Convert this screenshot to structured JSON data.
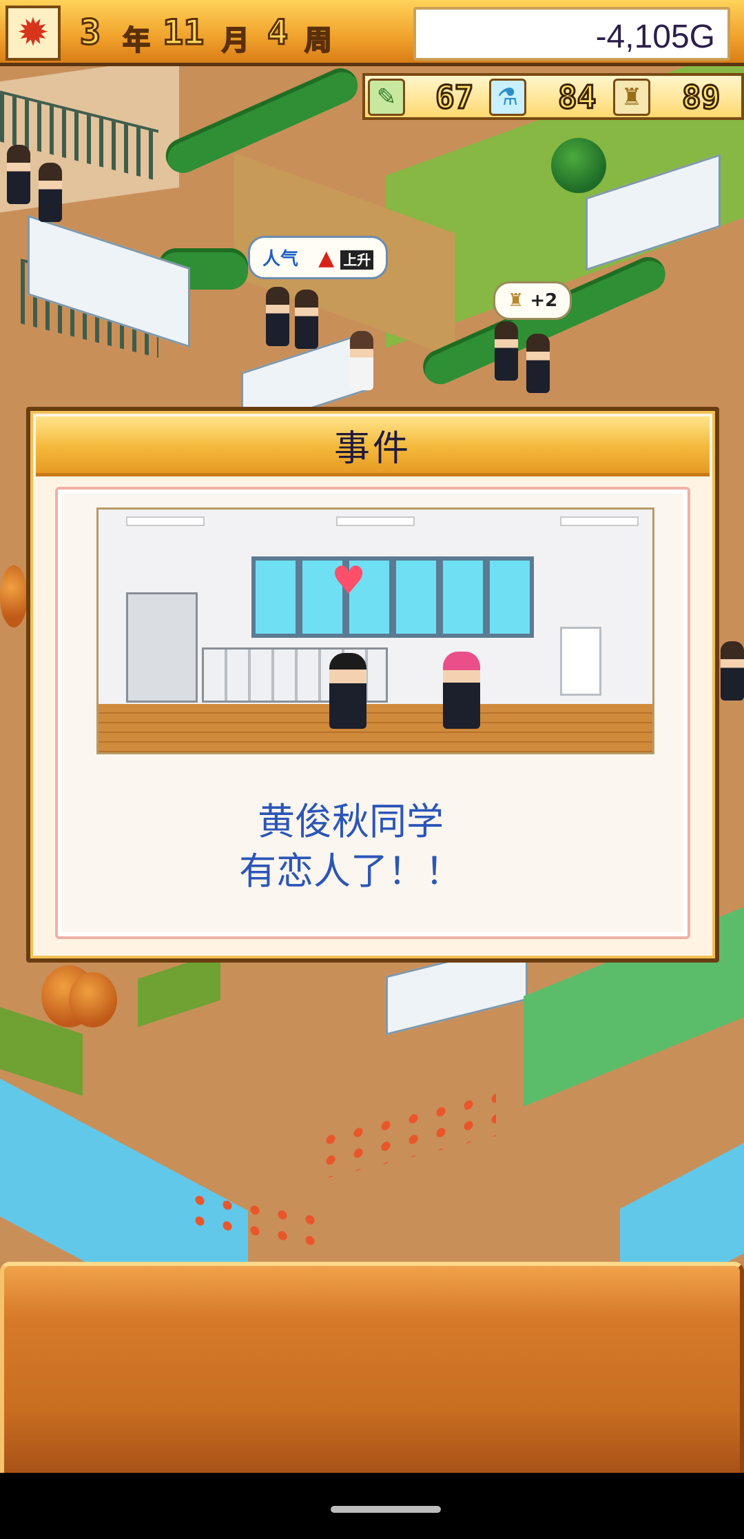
{
  "top_bar": {
    "season_icon": "maple-leaf-icon",
    "date": {
      "year": "3",
      "year_unit": "年",
      "month": "11",
      "month_unit": "月",
      "week": "4",
      "week_unit": "周"
    },
    "money": "-4,105G"
  },
  "stats": [
    {
      "icon": "pencil-icon",
      "value": "67"
    },
    {
      "icon": "flask-icon",
      "value": "84"
    },
    {
      "icon": "trophy-icon",
      "value": "89"
    }
  ],
  "world_bubbles": {
    "popularity": {
      "text": "人气",
      "badge": "上升"
    },
    "bonus": {
      "text": "+2"
    }
  },
  "event_dialog": {
    "title": "事件",
    "message_line1": "黄俊秋同学",
    "message_line2": "有恋人了！！"
  },
  "colors": {
    "title_bar": "#f4b83a",
    "message_text": "#2b56b8",
    "money_text": "#2b1f4a"
  }
}
